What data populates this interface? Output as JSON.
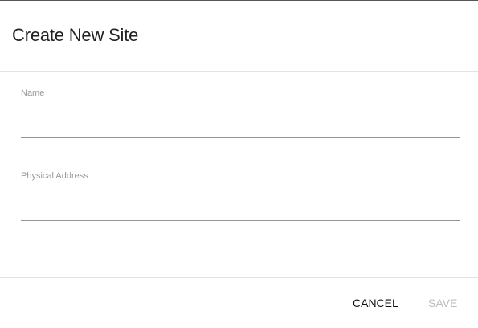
{
  "dialog": {
    "title": "Create New Site",
    "fields": [
      {
        "label": "Name",
        "value": ""
      },
      {
        "label": "Physical Address",
        "value": ""
      }
    ],
    "actions": {
      "cancel_label": "CANCEL",
      "save_label": "SAVE",
      "save_disabled": true
    }
  }
}
